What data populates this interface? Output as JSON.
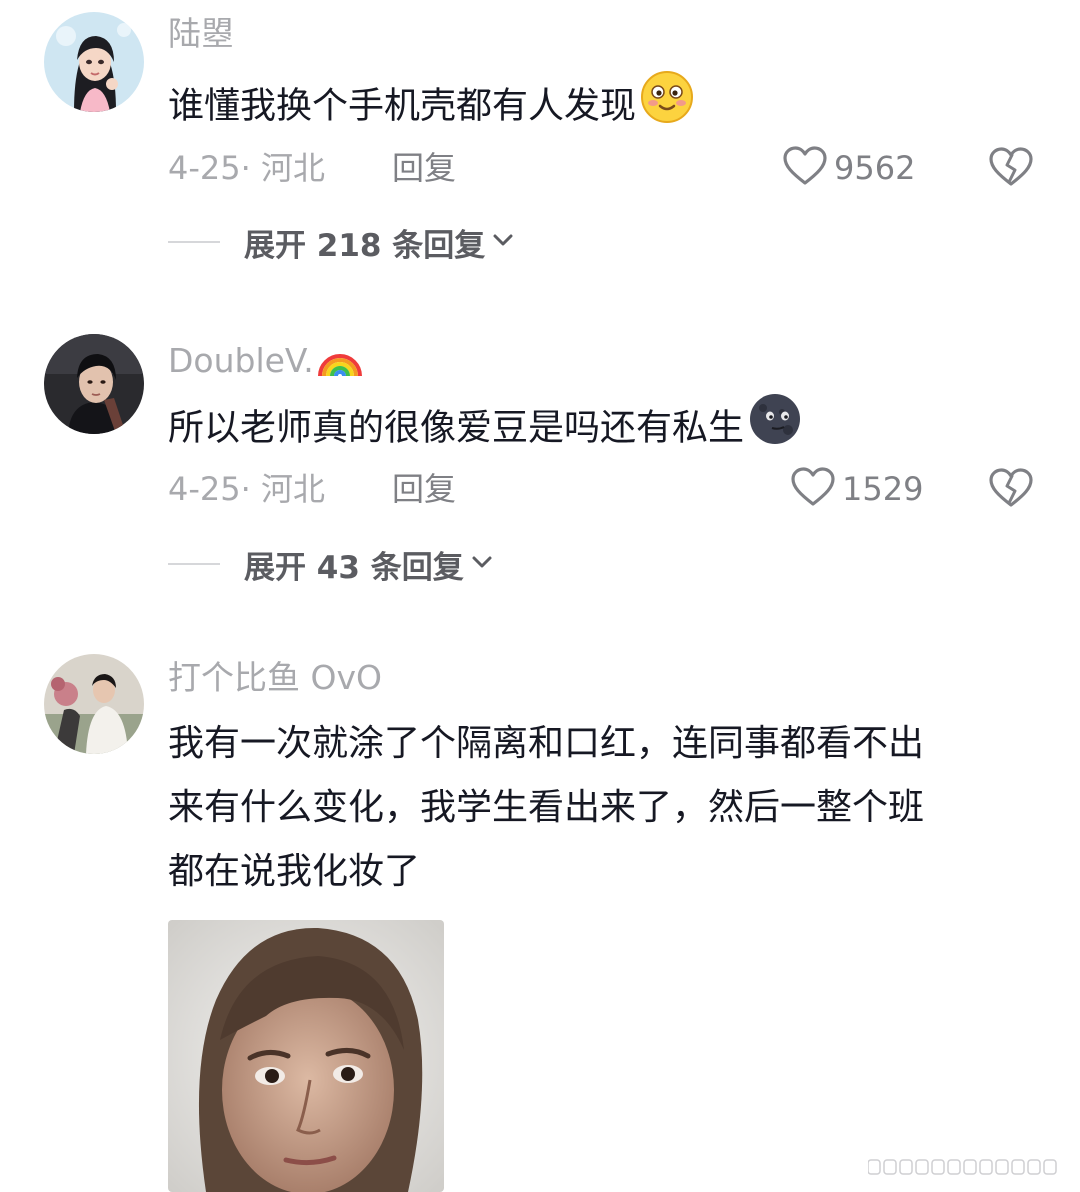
{
  "comments": [
    {
      "username": "陆曌",
      "text": "谁懂我换个手机壳都有人发现",
      "text_emoji": "smiling-face-icon",
      "date_location": "4-25· 河北",
      "reply_label": "回复",
      "likes": "9562",
      "expand_label": "展开 218 条回复"
    },
    {
      "username": "DoubleV.",
      "username_emoji": "rainbow-icon",
      "text": "所以老师真的很像爱豆是吗还有私生",
      "text_emoji": "new-moon-face-icon",
      "date_location": "4-25· 河北",
      "reply_label": "回复",
      "likes": "1529",
      "expand_label": "展开 43 条回复"
    },
    {
      "username": "打个比鱼 OvO",
      "text_lines": [
        "我有一次就涂了个隔离和口红，连同事都看不出",
        "来有什么变化，我学生看出来了，然后一整个班",
        "都在说我化妆了"
      ],
      "image": "woman-face-sticker"
    }
  ],
  "icons": {
    "like": "heart-outline-icon",
    "dislike": "broken-heart-icon",
    "expand": "chevron-down-icon"
  },
  "colors": {
    "text_primary": "#161823",
    "text_secondary": "#a8a9ad",
    "action_gray": "#7f8085"
  }
}
